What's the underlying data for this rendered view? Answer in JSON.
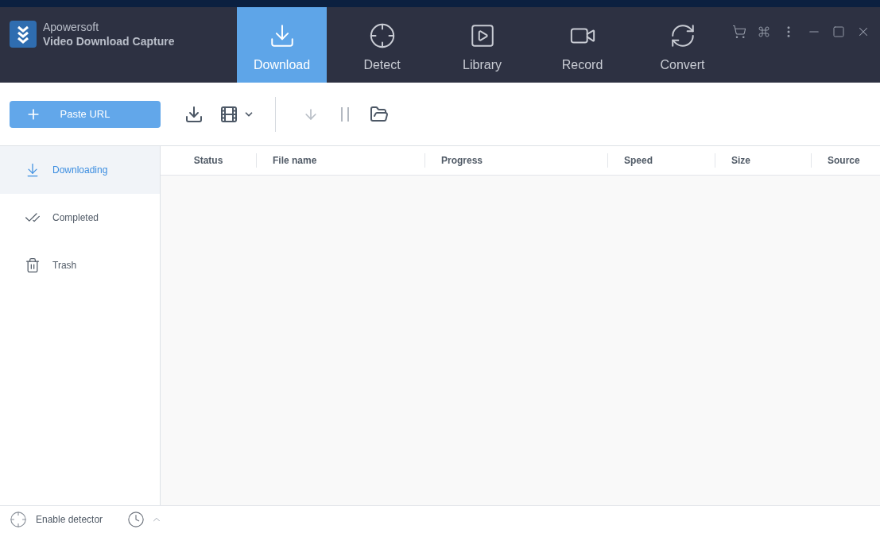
{
  "app": {
    "brand": "Apowersoft",
    "title": "Video Download Capture"
  },
  "tabs": [
    {
      "label": "Download",
      "selected": true
    },
    {
      "label": "Detect",
      "selected": false
    },
    {
      "label": "Library",
      "selected": false
    },
    {
      "label": "Record",
      "selected": false
    },
    {
      "label": "Convert",
      "selected": false
    }
  ],
  "toolbar": {
    "paste_button": "Paste URL"
  },
  "sidebar": {
    "items": [
      {
        "label": "Downloading",
        "selected": true
      },
      {
        "label": "Completed",
        "selected": false
      },
      {
        "label": "Trash",
        "selected": false
      }
    ]
  },
  "table": {
    "columns": [
      "Status",
      "File name",
      "Progress",
      "Speed",
      "Size",
      "Source"
    ]
  },
  "status_bar": {
    "detector_label": "Enable detector"
  }
}
